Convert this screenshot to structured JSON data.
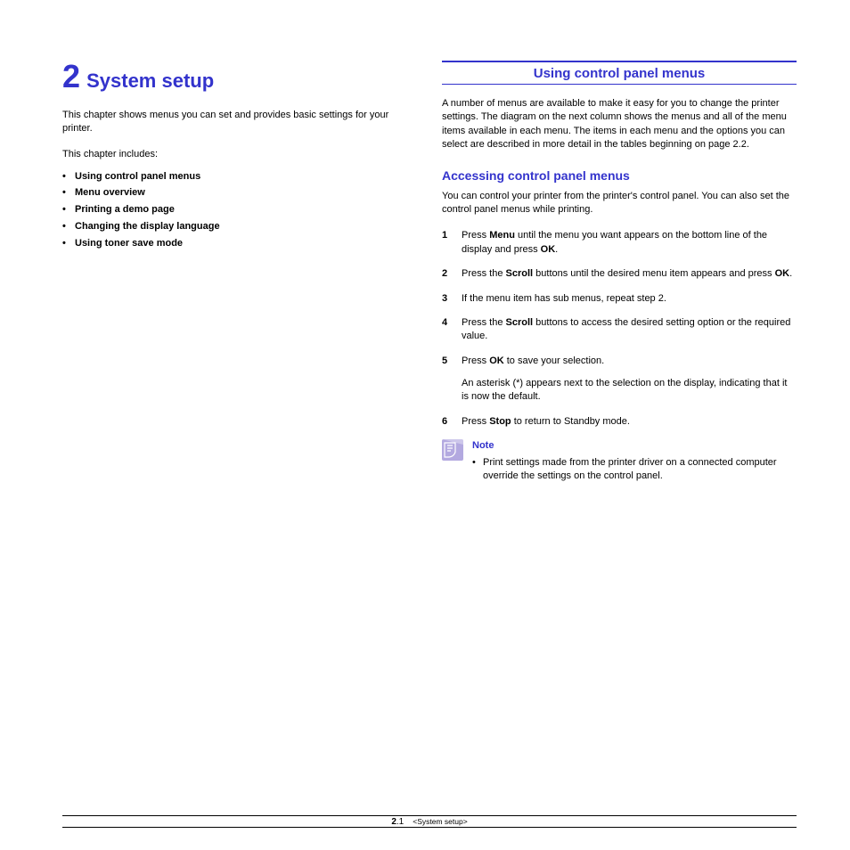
{
  "chapter": {
    "number": "2",
    "title": "System setup",
    "intro": "This chapter shows menus you can set and provides basic settings for your printer.",
    "includes_label": "This chapter includes:",
    "includes": [
      "Using control panel menus",
      "Menu overview",
      "Printing a demo page",
      "Changing the display language",
      "Using toner save mode"
    ]
  },
  "section": {
    "heading": "Using control panel menus",
    "body1": "A number of menus are available to make it easy for you to change the printer settings. The diagram on the next column shows the menus and all of the menu items available in each menu. The items in each menu and the options you can select are described in more detail in the tables beginning on page 2.2.",
    "subheading": "Accessing control panel menus",
    "body2": "You can control your printer from the printer's control panel. You can also set the control panel menus while printing.",
    "steps": [
      {
        "n": "1",
        "prefix": "Press ",
        "b1": "Menu",
        "mid": " until the menu you want appears on the bottom line of the display and press ",
        "b2": "OK",
        "suffix": "."
      },
      {
        "n": "2",
        "prefix": "Press the ",
        "b1": "Scroll",
        "mid": " buttons until the desired menu item appears and press ",
        "b2": "OK",
        "suffix": "."
      },
      {
        "n": "3",
        "prefix": "If the menu item has sub menus, repeat step 2.",
        "b1": "",
        "mid": "",
        "b2": "",
        "suffix": ""
      },
      {
        "n": "4",
        "prefix": "Press the ",
        "b1": "Scroll",
        "mid": " buttons to access the desired setting option or the required value.",
        "b2": "",
        "suffix": ""
      },
      {
        "n": "5",
        "prefix": "Press ",
        "b1": "OK",
        "mid": " to save your selection.",
        "b2": "",
        "suffix": "",
        "sub": "An asterisk (*) appears next to the selection on the display, indicating that it is now the default."
      },
      {
        "n": "6",
        "prefix": "Press ",
        "b1": "Stop",
        "mid": " to return to Standby mode.",
        "b2": "",
        "suffix": ""
      }
    ],
    "note": {
      "title": "Note",
      "text": "Print settings made from the printer driver on a connected computer override the settings on the control panel."
    }
  },
  "footer": {
    "page_bold": "2",
    "page_after": ".1",
    "tag": "<System setup>"
  }
}
